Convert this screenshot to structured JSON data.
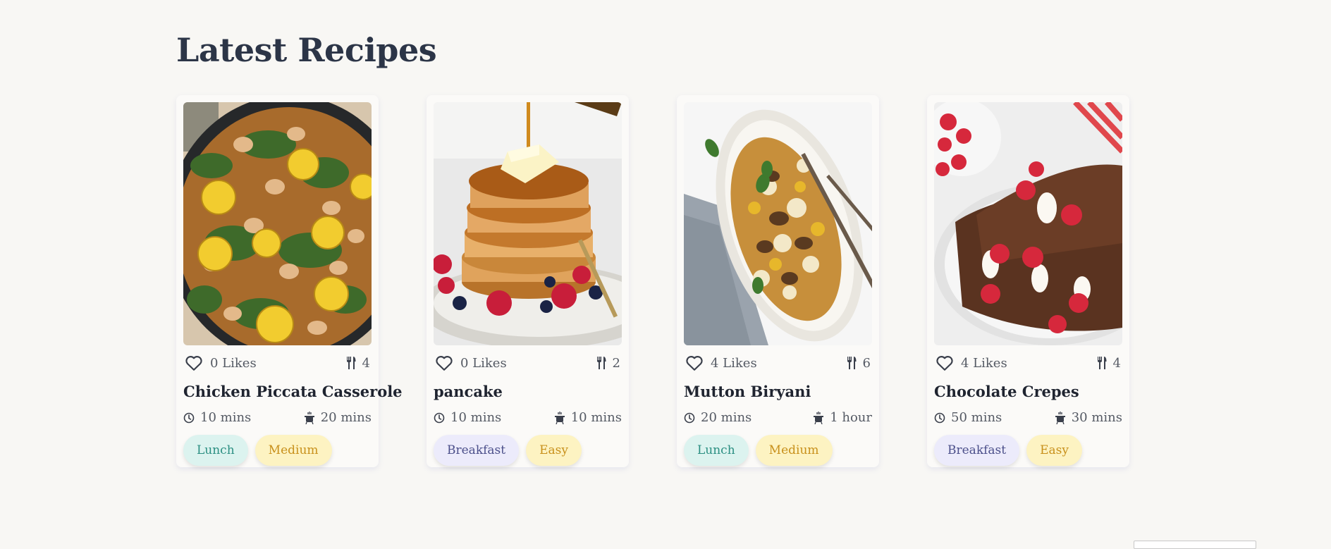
{
  "section": {
    "heading": "Latest Recipes"
  },
  "recipes": [
    {
      "likes": "0 Likes",
      "servings": "4",
      "title": "Chicken Piccata Casserole",
      "prep_time": "10 mins",
      "cook_time": "20 mins",
      "category": "Lunch",
      "difficulty": "Medium"
    },
    {
      "likes": "0 Likes",
      "servings": "2",
      "title": "pancake",
      "prep_time": "10 mins",
      "cook_time": "10 mins",
      "category": "Breakfast",
      "difficulty": "Easy"
    },
    {
      "likes": "4 Likes",
      "servings": "6",
      "title": "Mutton Biryani",
      "prep_time": "20 mins",
      "cook_time": "1 hour",
      "category": "Lunch",
      "difficulty": "Medium"
    },
    {
      "likes": "4 Likes",
      "servings": "4",
      "title": "Chocolate Crepes",
      "prep_time": "50 mins",
      "cook_time": "30 mins",
      "category": "Breakfast",
      "difficulty": "Easy"
    }
  ],
  "colors": {
    "background": "#f8f7f4",
    "heading": "#2c3547",
    "tag_lunch": "#dcf3ef",
    "tag_breakfast": "#ecebfb",
    "tag_difficulty": "#fdf3c2"
  },
  "icons": [
    "heart-icon",
    "utensils-icon",
    "clock-icon",
    "cooking-pot-icon"
  ]
}
